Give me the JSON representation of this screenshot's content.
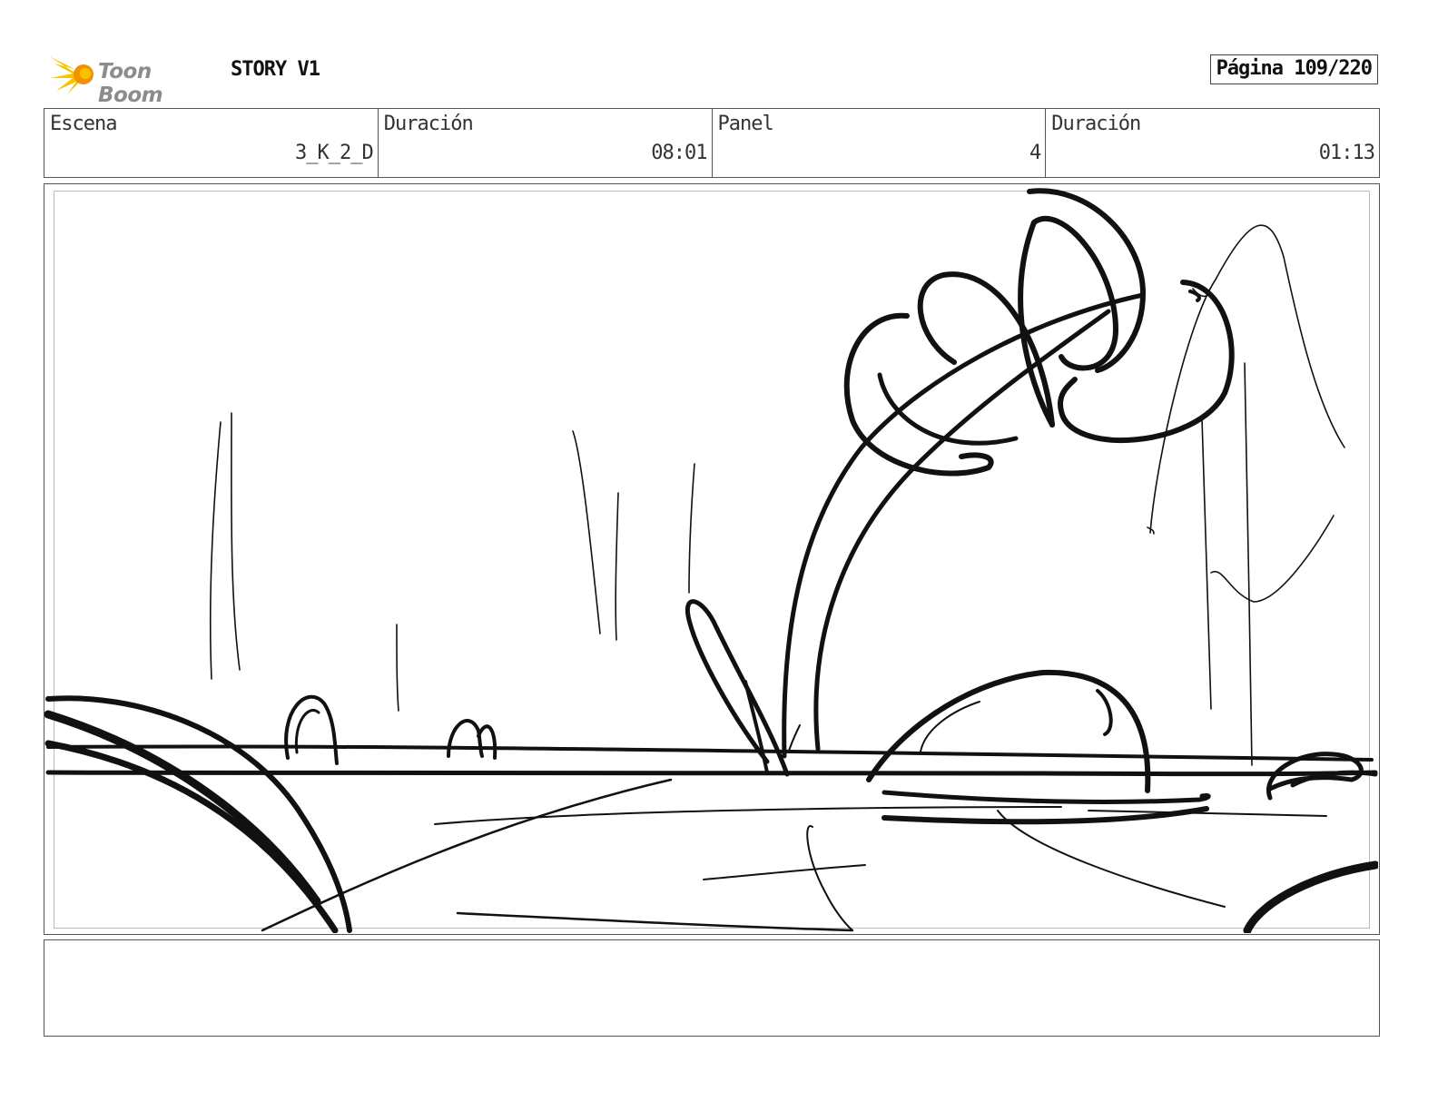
{
  "header": {
    "brand": "Toon Boom",
    "project_title": "STORY V1",
    "page_label": "Página 109/220"
  },
  "info": {
    "scene_label": "Escena",
    "scene_value": "3_K_2_D",
    "scene_duration_label": "Duración",
    "scene_duration_value": "08:01",
    "panel_label": "Panel",
    "panel_value": "4",
    "panel_duration_label": "Duración",
    "panel_duration_value": "01:13"
  },
  "colors": {
    "logo_yellow": "#f5c400",
    "logo_orange": "#f39200",
    "ink": "#111111"
  },
  "icons": {
    "logo": "toon-boom-star-icon"
  }
}
